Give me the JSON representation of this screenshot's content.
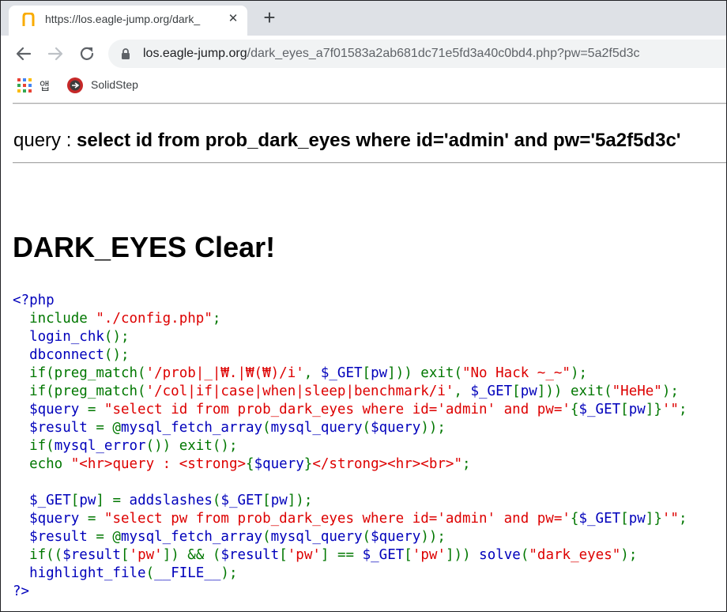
{
  "browser": {
    "tab": {
      "title": "https://los.eagle-jump.org/dark_",
      "close_glyph": "✕"
    },
    "new_tab_glyph": "+",
    "address": {
      "host": "los.eagle-jump.org",
      "path": "/dark_eyes_a7f01583a2ab681dc71e5fd3a40c0bd4.php?pw=5a2f5d3c"
    },
    "bookmarks": [
      {
        "label": "앱",
        "icon": "apps-grid-icon"
      },
      {
        "label": "SolidStep",
        "icon": "solidstep-icon"
      }
    ]
  },
  "page": {
    "query_prefix": "query : ",
    "query_sql": "select id from prob_dark_eyes where id='admin' and pw='5a2f5d3c'",
    "clear_heading": "DARK_EYES Clear!",
    "code_lines": [
      [
        {
          "c": "d",
          "t": "<?php"
        }
      ],
      [
        {
          "c": "k",
          "t": "  include "
        },
        {
          "c": "s",
          "t": "\"./config.php\""
        },
        {
          "c": "k",
          "t": ";"
        }
      ],
      [
        {
          "c": "d",
          "t": "  login_chk"
        },
        {
          "c": "k",
          "t": "();"
        }
      ],
      [
        {
          "c": "d",
          "t": "  dbconnect"
        },
        {
          "c": "k",
          "t": "();"
        }
      ],
      [
        {
          "c": "k",
          "t": "  if(preg_match("
        },
        {
          "c": "s",
          "t": "'/prob|_|₩.|₩(₩)/i'"
        },
        {
          "c": "k",
          "t": ", "
        },
        {
          "c": "d",
          "t": "$_GET"
        },
        {
          "c": "k",
          "t": "["
        },
        {
          "c": "d",
          "t": "pw"
        },
        {
          "c": "k",
          "t": "])) exit("
        },
        {
          "c": "s",
          "t": "\"No Hack ~_~\""
        },
        {
          "c": "k",
          "t": ");"
        }
      ],
      [
        {
          "c": "k",
          "t": "  if(preg_match("
        },
        {
          "c": "s",
          "t": "'/col|if|case|when|sleep|benchmark/i'"
        },
        {
          "c": "k",
          "t": ", "
        },
        {
          "c": "d",
          "t": "$_GET"
        },
        {
          "c": "k",
          "t": "["
        },
        {
          "c": "d",
          "t": "pw"
        },
        {
          "c": "k",
          "t": "])) exit("
        },
        {
          "c": "s",
          "t": "\"HeHe\""
        },
        {
          "c": "k",
          "t": ");"
        }
      ],
      [
        {
          "c": "d",
          "t": "  $query "
        },
        {
          "c": "k",
          "t": "= "
        },
        {
          "c": "s",
          "t": "\"select id from prob_dark_eyes where id='admin' and pw='"
        },
        {
          "c": "k",
          "t": "{"
        },
        {
          "c": "d",
          "t": "$_GET"
        },
        {
          "c": "k",
          "t": "["
        },
        {
          "c": "d",
          "t": "pw"
        },
        {
          "c": "k",
          "t": "]}"
        },
        {
          "c": "s",
          "t": "'\""
        },
        {
          "c": "k",
          "t": ";"
        }
      ],
      [
        {
          "c": "d",
          "t": "  $result "
        },
        {
          "c": "k",
          "t": "= @"
        },
        {
          "c": "d",
          "t": "mysql_fetch_array"
        },
        {
          "c": "k",
          "t": "("
        },
        {
          "c": "d",
          "t": "mysql_query"
        },
        {
          "c": "k",
          "t": "("
        },
        {
          "c": "d",
          "t": "$query"
        },
        {
          "c": "k",
          "t": "));"
        }
      ],
      [
        {
          "c": "k",
          "t": "  if("
        },
        {
          "c": "d",
          "t": "mysql_error"
        },
        {
          "c": "k",
          "t": "()) exit();"
        }
      ],
      [
        {
          "c": "k",
          "t": "  echo "
        },
        {
          "c": "s",
          "t": "\"<hr>query : <strong>"
        },
        {
          "c": "k",
          "t": "{"
        },
        {
          "c": "d",
          "t": "$query"
        },
        {
          "c": "k",
          "t": "}"
        },
        {
          "c": "s",
          "t": "</strong><hr><br>\""
        },
        {
          "c": "k",
          "t": ";"
        }
      ],
      [
        {
          "c": "k",
          "t": ""
        }
      ],
      [
        {
          "c": "d",
          "t": "  $_GET"
        },
        {
          "c": "k",
          "t": "["
        },
        {
          "c": "d",
          "t": "pw"
        },
        {
          "c": "k",
          "t": "] = "
        },
        {
          "c": "d",
          "t": "addslashes"
        },
        {
          "c": "k",
          "t": "("
        },
        {
          "c": "d",
          "t": "$_GET"
        },
        {
          "c": "k",
          "t": "["
        },
        {
          "c": "d",
          "t": "pw"
        },
        {
          "c": "k",
          "t": "]);"
        }
      ],
      [
        {
          "c": "d",
          "t": "  $query "
        },
        {
          "c": "k",
          "t": "= "
        },
        {
          "c": "s",
          "t": "\"select pw from prob_dark_eyes where id='admin' and pw='"
        },
        {
          "c": "k",
          "t": "{"
        },
        {
          "c": "d",
          "t": "$_GET"
        },
        {
          "c": "k",
          "t": "["
        },
        {
          "c": "d",
          "t": "pw"
        },
        {
          "c": "k",
          "t": "]}"
        },
        {
          "c": "s",
          "t": "'\""
        },
        {
          "c": "k",
          "t": ";"
        }
      ],
      [
        {
          "c": "d",
          "t": "  $result "
        },
        {
          "c": "k",
          "t": "= @"
        },
        {
          "c": "d",
          "t": "mysql_fetch_array"
        },
        {
          "c": "k",
          "t": "("
        },
        {
          "c": "d",
          "t": "mysql_query"
        },
        {
          "c": "k",
          "t": "("
        },
        {
          "c": "d",
          "t": "$query"
        },
        {
          "c": "k",
          "t": "));"
        }
      ],
      [
        {
          "c": "k",
          "t": "  if(("
        },
        {
          "c": "d",
          "t": "$result"
        },
        {
          "c": "k",
          "t": "["
        },
        {
          "c": "s",
          "t": "'pw'"
        },
        {
          "c": "k",
          "t": "]) && ("
        },
        {
          "c": "d",
          "t": "$result"
        },
        {
          "c": "k",
          "t": "["
        },
        {
          "c": "s",
          "t": "'pw'"
        },
        {
          "c": "k",
          "t": "] == "
        },
        {
          "c": "d",
          "t": "$_GET"
        },
        {
          "c": "k",
          "t": "["
        },
        {
          "c": "s",
          "t": "'pw'"
        },
        {
          "c": "k",
          "t": "])) "
        },
        {
          "c": "d",
          "t": "solve"
        },
        {
          "c": "k",
          "t": "("
        },
        {
          "c": "s",
          "t": "\"dark_eyes\""
        },
        {
          "c": "k",
          "t": ");"
        }
      ],
      [
        {
          "c": "d",
          "t": "  highlight_file"
        },
        {
          "c": "k",
          "t": "("
        },
        {
          "c": "d",
          "t": "__FILE__"
        },
        {
          "c": "k",
          "t": ");"
        }
      ],
      [
        {
          "c": "d",
          "t": "?>"
        }
      ]
    ]
  },
  "colors": {
    "php_default": "#0000bb",
    "php_keyword": "#007700",
    "php_string": "#dd0000",
    "tab_strip": "#dee1e6",
    "omnibox": "#f1f3f4",
    "favicon": "#f9ab00",
    "solidstep_ring": "#c62828"
  }
}
